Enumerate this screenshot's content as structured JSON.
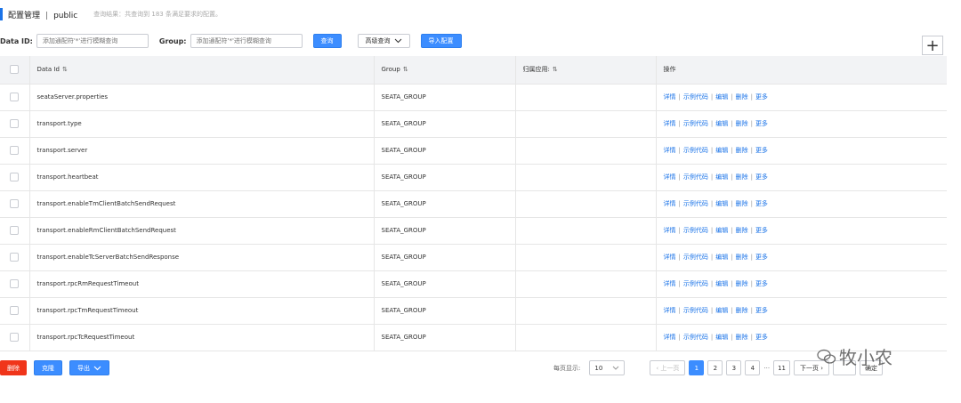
{
  "header": {
    "title": "配置管理",
    "separator": "|",
    "namespace": "public",
    "result_text": "查询结果：共查询到 183 条满足要求的配置。"
  },
  "search": {
    "data_id_label": "Data ID:",
    "data_id_placeholder": "添加通配符'*'进行模糊查询",
    "group_label": "Group:",
    "group_placeholder": "添加通配符'*'进行模糊查询",
    "query_button": "查询",
    "advanced_button": "高级查询",
    "import_button": "导入配置",
    "add_button": "+"
  },
  "table": {
    "columns": [
      "Data Id",
      "Group",
      "归属应用:",
      "操作"
    ],
    "rows": [
      {
        "data_id": "seataServer.properties",
        "group": "SEATA_GROUP",
        "app": ""
      },
      {
        "data_id": "transport.type",
        "group": "SEATA_GROUP",
        "app": ""
      },
      {
        "data_id": "transport.server",
        "group": "SEATA_GROUP",
        "app": ""
      },
      {
        "data_id": "transport.heartbeat",
        "group": "SEATA_GROUP",
        "app": ""
      },
      {
        "data_id": "transport.enableTmClientBatchSendRequest",
        "group": "SEATA_GROUP",
        "app": ""
      },
      {
        "data_id": "transport.enableRmClientBatchSendRequest",
        "group": "SEATA_GROUP",
        "app": ""
      },
      {
        "data_id": "transport.enableTcServerBatchSendResponse",
        "group": "SEATA_GROUP",
        "app": ""
      },
      {
        "data_id": "transport.rpcRmRequestTimeout",
        "group": "SEATA_GROUP",
        "app": ""
      },
      {
        "data_id": "transport.rpcTmRequestTimeout",
        "group": "SEATA_GROUP",
        "app": ""
      },
      {
        "data_id": "transport.rpcTcRequestTimeout",
        "group": "SEATA_GROUP",
        "app": ""
      }
    ],
    "actions": [
      "详情",
      "示例代码",
      "编辑",
      "删除",
      "更多"
    ]
  },
  "footer": {
    "delete_button": "删除",
    "clone_button": "克隆",
    "export_button": "导出",
    "page_size_label": "每页显示:",
    "page_size_value": "10",
    "prev_label": "上一页",
    "pages": [
      "1",
      "2",
      "3",
      "4"
    ],
    "ellipsis": "···",
    "last_page": "11",
    "next_label": "下一页",
    "confirm_button": "确定"
  },
  "watermark": {
    "text": "牧小农"
  },
  "colors": {
    "accent": "#1a73e8",
    "primary_button": "#3c8dff",
    "danger_button": "#f0351a",
    "header_bg": "#f2f3f5",
    "link": "#1a73e8"
  }
}
